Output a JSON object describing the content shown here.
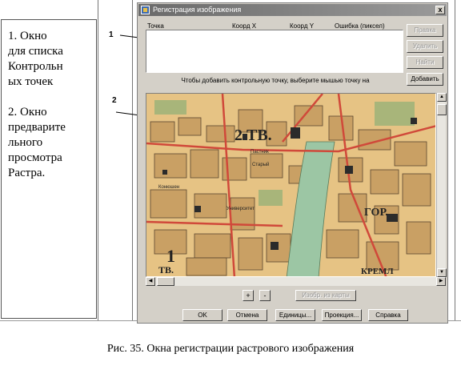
{
  "annotation": {
    "item1_lines": [
      "1. Окно",
      "для списка",
      "Контрольн",
      "ых точек"
    ],
    "item2_lines": [
      "2. Окно",
      "предварите",
      "льного",
      "просмотра",
      "Растра."
    ]
  },
  "callouts": {
    "one": "1",
    "two": "2"
  },
  "window": {
    "title": "Регистрация изображения",
    "close_label": "x"
  },
  "point_list": {
    "columns": [
      "Точка",
      "Коорд X",
      "Коорд Y",
      "Ошибка (пиксел)"
    ]
  },
  "side_buttons": {
    "edit": "Правка",
    "delete": "Удалить",
    "find": "Найти",
    "add": "Добавить"
  },
  "hint_text": "Чтобы добавить контрольную точку, выберите мышью точку на",
  "map_labels": {
    "district_2": "2 ТВ.",
    "district_1": "1",
    "district_1b": "ТВ.",
    "gor": "ГОР.",
    "kreml": "КРЕМЛ",
    "street_a": "Пастник",
    "street_b": "Старый",
    "street_c": "Университет",
    "street_d": "Конюшен"
  },
  "zoom": {
    "in": "+",
    "out": "-"
  },
  "image_from_map": "Изобр. из карты",
  "bottom_buttons": {
    "ok": "OK",
    "cancel": "Отмена",
    "units": "Единицы...",
    "projection": "Проекция...",
    "help": "Справка"
  },
  "caption": "Рис. 35. Окна  регистрации растрового изображения",
  "colors": {
    "window_bg": "#d4d0c8",
    "map_bg": "#e6c384",
    "map_block": "#c9a064",
    "map_red": "#d0493a",
    "map_river": "#9cc6a4",
    "map_dark": "#2b2b2b"
  }
}
